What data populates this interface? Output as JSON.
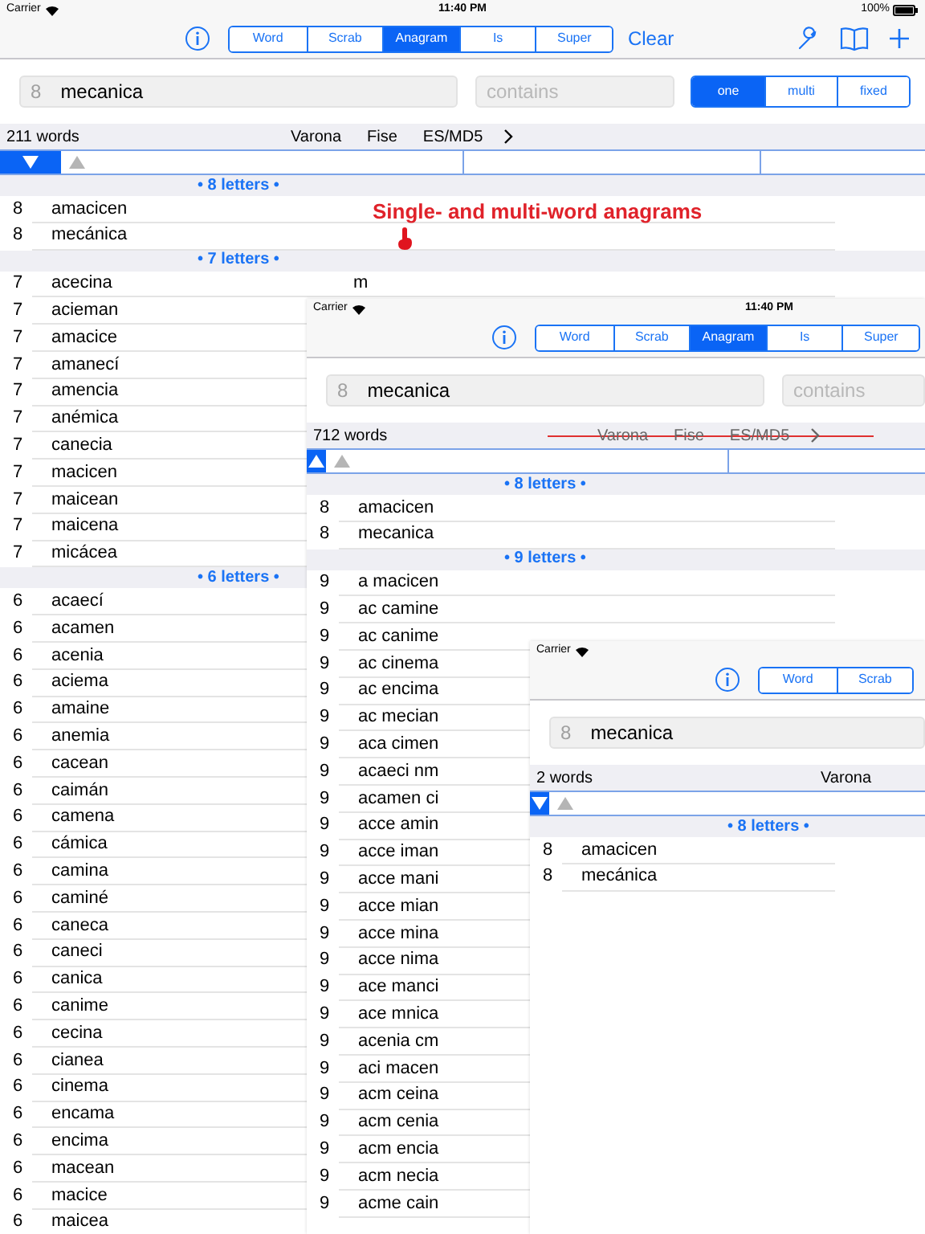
{
  "screens": [
    {
      "status_bar": {
        "carrier": "Carrier",
        "time": "11:40 PM",
        "battery": "100%"
      },
      "tabs": [
        {
          "label": "Word",
          "selected": false
        },
        {
          "label": "Scrab",
          "selected": false
        },
        {
          "label": "Anagram",
          "selected": true
        },
        {
          "label": "Is",
          "selected": false
        },
        {
          "label": "Super",
          "selected": false
        }
      ],
      "clear": "Clear",
      "search": {
        "length": "8",
        "query": "mecanica",
        "contains_placeholder": "contains"
      },
      "word_modes": [
        {
          "label": "one",
          "selected": true
        },
        {
          "label": "multi",
          "selected": false
        },
        {
          "label": "fixed",
          "selected": false
        }
      ],
      "results_bar": {
        "count": "211 words",
        "sources": [
          "Varona",
          "Fise",
          "ES/MD5"
        ],
        "more_chevron": true,
        "sources_struck": false
      },
      "sort_descending": true,
      "sections": [
        {
          "title": "• 8 letters •",
          "rows": [
            {
              "length": "8",
              "word": "amacicen"
            },
            {
              "length": "8",
              "word": "mecánica"
            }
          ]
        },
        {
          "title": "• 7 letters •",
          "rows": [
            {
              "length": "7",
              "word": "acecina",
              "column_3": "m"
            },
            {
              "length": "7",
              "word": "acieman"
            },
            {
              "length": "7",
              "word": "amacice"
            },
            {
              "length": "7",
              "word": "amanecí"
            },
            {
              "length": "7",
              "word": "amencia"
            },
            {
              "length": "7",
              "word": "anémica"
            },
            {
              "length": "7",
              "word": "canecia"
            },
            {
              "length": "7",
              "word": "macicen"
            },
            {
              "length": "7",
              "word": "maicean"
            },
            {
              "length": "7",
              "word": "maicena"
            },
            {
              "length": "7",
              "word": "micácea"
            }
          ]
        },
        {
          "title": "• 6 letters •",
          "rows": [
            {
              "length": "6",
              "word": "acaecí"
            },
            {
              "length": "6",
              "word": "acamen"
            },
            {
              "length": "6",
              "word": "acenia"
            },
            {
              "length": "6",
              "word": "aciema"
            },
            {
              "length": "6",
              "word": "amaine"
            },
            {
              "length": "6",
              "word": "anemia"
            },
            {
              "length": "6",
              "word": "cacean"
            },
            {
              "length": "6",
              "word": "caimán"
            },
            {
              "length": "6",
              "word": "camena"
            },
            {
              "length": "6",
              "word": "cámica"
            },
            {
              "length": "6",
              "word": "camina"
            },
            {
              "length": "6",
              "word": "caminé"
            },
            {
              "length": "6",
              "word": "caneca"
            },
            {
              "length": "6",
              "word": "caneci"
            },
            {
              "length": "6",
              "word": "canica"
            },
            {
              "length": "6",
              "word": "canime"
            },
            {
              "length": "6",
              "word": "cecina"
            },
            {
              "length": "6",
              "word": "cianea"
            },
            {
              "length": "6",
              "word": "cinema"
            },
            {
              "length": "6",
              "word": "encama"
            },
            {
              "length": "6",
              "word": "encima"
            },
            {
              "length": "6",
              "word": "macean"
            },
            {
              "length": "6",
              "word": "macice"
            },
            {
              "length": "6",
              "word": "maicea"
            }
          ]
        }
      ]
    },
    {
      "status_bar": {
        "carrier": "Carrier",
        "time": "11:40 PM"
      },
      "tabs": [
        {
          "label": "Word",
          "selected": false
        },
        {
          "label": "Scrab",
          "selected": false
        },
        {
          "label": "Anagram",
          "selected": true
        },
        {
          "label": "Is",
          "selected": false
        },
        {
          "label": "Super",
          "selected": false
        }
      ],
      "search": {
        "length": "8",
        "query": "mecanica",
        "contains_placeholder": "contains"
      },
      "results_bar": {
        "count": "712 words",
        "sources": [
          "Varona",
          "Fise",
          "ES/MD5"
        ],
        "more_chevron": true,
        "sources_struck": true
      },
      "sort_descending": false,
      "sections": [
        {
          "title": "• 8 letters •",
          "rows": [
            {
              "length": "8",
              "word": "amacicen"
            },
            {
              "length": "8",
              "word": "mecanica"
            }
          ]
        },
        {
          "title": "• 9 letters •",
          "rows": [
            {
              "length": "9",
              "word": "a macicen"
            },
            {
              "length": "9",
              "word": "ac camine"
            },
            {
              "length": "9",
              "word": "ac canime"
            },
            {
              "length": "9",
              "word": "ac cinema"
            },
            {
              "length": "9",
              "word": "ac encima"
            },
            {
              "length": "9",
              "word": "ac mecian"
            },
            {
              "length": "9",
              "word": "aca cimen"
            },
            {
              "length": "9",
              "word": "acaeci nm"
            },
            {
              "length": "9",
              "word": "acamen ci"
            },
            {
              "length": "9",
              "word": "acce amin"
            },
            {
              "length": "9",
              "word": "acce iman"
            },
            {
              "length": "9",
              "word": "acce mani"
            },
            {
              "length": "9",
              "word": "acce mian"
            },
            {
              "length": "9",
              "word": "acce mina"
            },
            {
              "length": "9",
              "word": "acce nima"
            },
            {
              "length": "9",
              "word": "ace manci"
            },
            {
              "length": "9",
              "word": "ace mnica"
            },
            {
              "length": "9",
              "word": "acenia cm"
            },
            {
              "length": "9",
              "word": "aci macen"
            },
            {
              "length": "9",
              "word": "acm ceina"
            },
            {
              "length": "9",
              "word": "acm cenia"
            },
            {
              "length": "9",
              "word": "acm encia"
            },
            {
              "length": "9",
              "word": "acm necia"
            },
            {
              "length": "9",
              "word": "acme cain"
            }
          ]
        }
      ]
    },
    {
      "status_bar": {
        "carrier": "Carrier"
      },
      "tabs": [
        {
          "label": "Word",
          "selected": false
        },
        {
          "label": "Scrab",
          "selected": false
        }
      ],
      "search": {
        "length": "8",
        "query": "mecanica"
      },
      "results_bar": {
        "count": "2 words",
        "sources": [
          "Varona"
        ],
        "more_chevron": false,
        "sources_struck": false
      },
      "sort_descending": true,
      "sections": [
        {
          "title": "• 8 letters •",
          "rows": [
            {
              "length": "8",
              "word": "amacicen"
            },
            {
              "length": "8",
              "word": "mecánica"
            }
          ]
        }
      ]
    }
  ],
  "annotation": "Single- and multi-word anagrams"
}
